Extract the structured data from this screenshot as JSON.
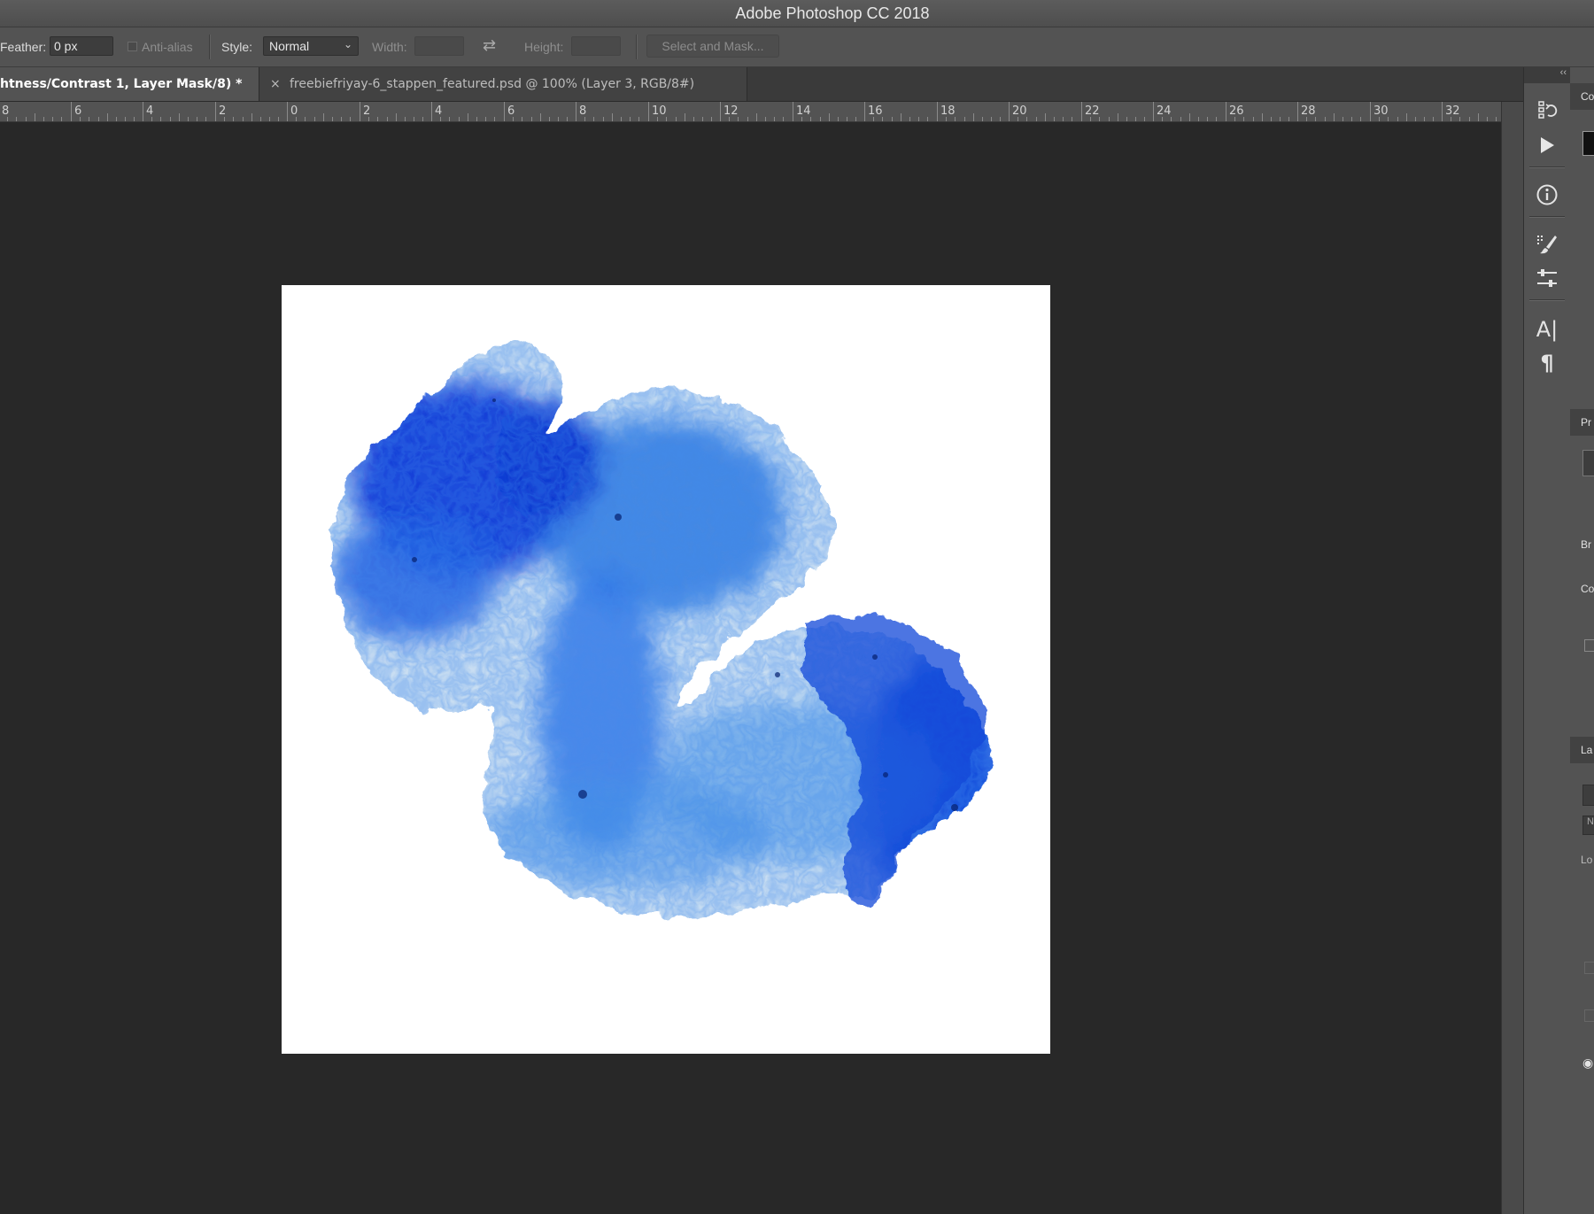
{
  "window": {
    "title": "Adobe Photoshop CC 2018"
  },
  "options_bar": {
    "feather_label": "Feather:",
    "feather_value": "0 px",
    "antialias_label": "Anti-alias",
    "style_label": "Style:",
    "style_value": "Normal",
    "width_label": "Width:",
    "width_value": "",
    "height_label": "Height:",
    "height_value": "",
    "select_mask_label": "Select and Mask..."
  },
  "tabs": [
    {
      "label": "htness/Contrast 1, Layer Mask/8) *",
      "active": true
    },
    {
      "label": "freebiefriyay-6_stappen_featured.psd @ 100% (Layer 3, RGB/8#)",
      "active": false,
      "close": "×"
    }
  ],
  "ruler": {
    "labels": [
      "8",
      "6",
      "4",
      "2",
      "0",
      "2",
      "4",
      "6",
      "8",
      "10",
      "12",
      "14",
      "16",
      "18",
      "20",
      "22",
      "24",
      "26",
      "28",
      "30",
      "32"
    ]
  },
  "dock": {
    "collapse": "‹‹",
    "icons": [
      "history-icon",
      "actions-play-icon",
      "info-icon",
      "brush-settings-icon",
      "adjustments-icon",
      "character-icon",
      "paragraph-icon"
    ],
    "char_glyph": "A|",
    "para_glyph": "¶"
  },
  "right_panel": {
    "labels": [
      "Co",
      "Pr",
      "Br",
      "Co",
      "La",
      "N",
      "Lo"
    ]
  },
  "colors": {
    "accent_blue": "#1a4fe0",
    "canvas_bg": "#282828",
    "panel_bg": "#535353"
  }
}
